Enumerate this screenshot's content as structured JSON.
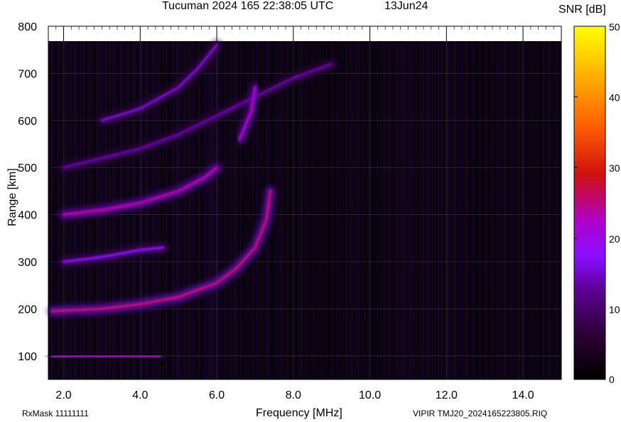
{
  "header": {
    "title": "Tucuman 2024 165 22:38:05 UTC",
    "date": "13Jun24"
  },
  "footer": {
    "rxmask": "RxMask 11111111",
    "file": "VIPIR  TMJ20_2024165223805.RIQ"
  },
  "colorbar": {
    "title": "SNR [dB]",
    "min": 0,
    "max": 50,
    "ticks": [
      "0",
      "10",
      "20",
      "30",
      "40",
      "50"
    ],
    "stops": [
      "#000000",
      "#2a0030",
      "#5a0090",
      "#8a10ff",
      "#b000c8",
      "#d01010",
      "#ff6000",
      "#ffb000",
      "#ffff00"
    ]
  },
  "chart_data": {
    "type": "heatmap",
    "title": "Tucuman 2024 165 22:38:05 UTC",
    "xlabel": "Frequency [MHz]",
    "ylabel": "Range [km]",
    "xlim": [
      1.6,
      15.0
    ],
    "ylim": [
      50,
      800
    ],
    "xticks": [
      "2.0",
      "4.0",
      "6.0",
      "8.0",
      "10.0",
      "12.0",
      "14.0"
    ],
    "xtick_values": [
      2,
      4,
      6,
      8,
      10,
      12,
      14
    ],
    "yticks": [
      "100",
      "200",
      "300",
      "400",
      "500",
      "600",
      "700",
      "800"
    ],
    "ytick_values": [
      100,
      200,
      300,
      400,
      500,
      600,
      700,
      800
    ],
    "grid": true,
    "traces": [
      {
        "name": "",
        "snr": 25,
        "points": [
          [
            1.7,
            98
          ],
          [
            2.5,
            100
          ],
          [
            3.5,
            100
          ],
          [
            4.5,
            100
          ]
        ]
      },
      {
        "name": "",
        "snr": 28,
        "points": [
          [
            1.7,
            195
          ],
          [
            3.0,
            200
          ],
          [
            4.0,
            210
          ],
          [
            5.0,
            225
          ],
          [
            6.0,
            255
          ],
          [
            6.5,
            285
          ],
          [
            7.0,
            330
          ],
          [
            7.3,
            390
          ],
          [
            7.4,
            450
          ]
        ]
      },
      {
        "name": "",
        "snr": 18,
        "points": [
          [
            2.0,
            300
          ],
          [
            3.0,
            310
          ],
          [
            4.0,
            325
          ],
          [
            4.6,
            330
          ]
        ]
      },
      {
        "name": "",
        "snr": 26,
        "points": [
          [
            2.0,
            400
          ],
          [
            3.0,
            410
          ],
          [
            4.0,
            425
          ],
          [
            5.0,
            450
          ],
          [
            5.7,
            480
          ],
          [
            6.0,
            500
          ]
        ]
      },
      {
        "name": "",
        "snr": 14,
        "points": [
          [
            2.0,
            500
          ],
          [
            3.0,
            520
          ],
          [
            4.0,
            540
          ],
          [
            5.0,
            570
          ],
          [
            6.0,
            610
          ],
          [
            7.0,
            650
          ],
          [
            8.0,
            690
          ],
          [
            9.0,
            720
          ]
        ]
      },
      {
        "name": "",
        "snr": 16,
        "points": [
          [
            3.0,
            600
          ],
          [
            4.0,
            625
          ],
          [
            5.0,
            670
          ],
          [
            5.5,
            710
          ],
          [
            6.0,
            760
          ]
        ]
      },
      {
        "name": "",
        "snr": 24,
        "points": [
          [
            6.6,
            560
          ],
          [
            6.9,
            620
          ],
          [
            7.0,
            670
          ]
        ]
      }
    ]
  }
}
